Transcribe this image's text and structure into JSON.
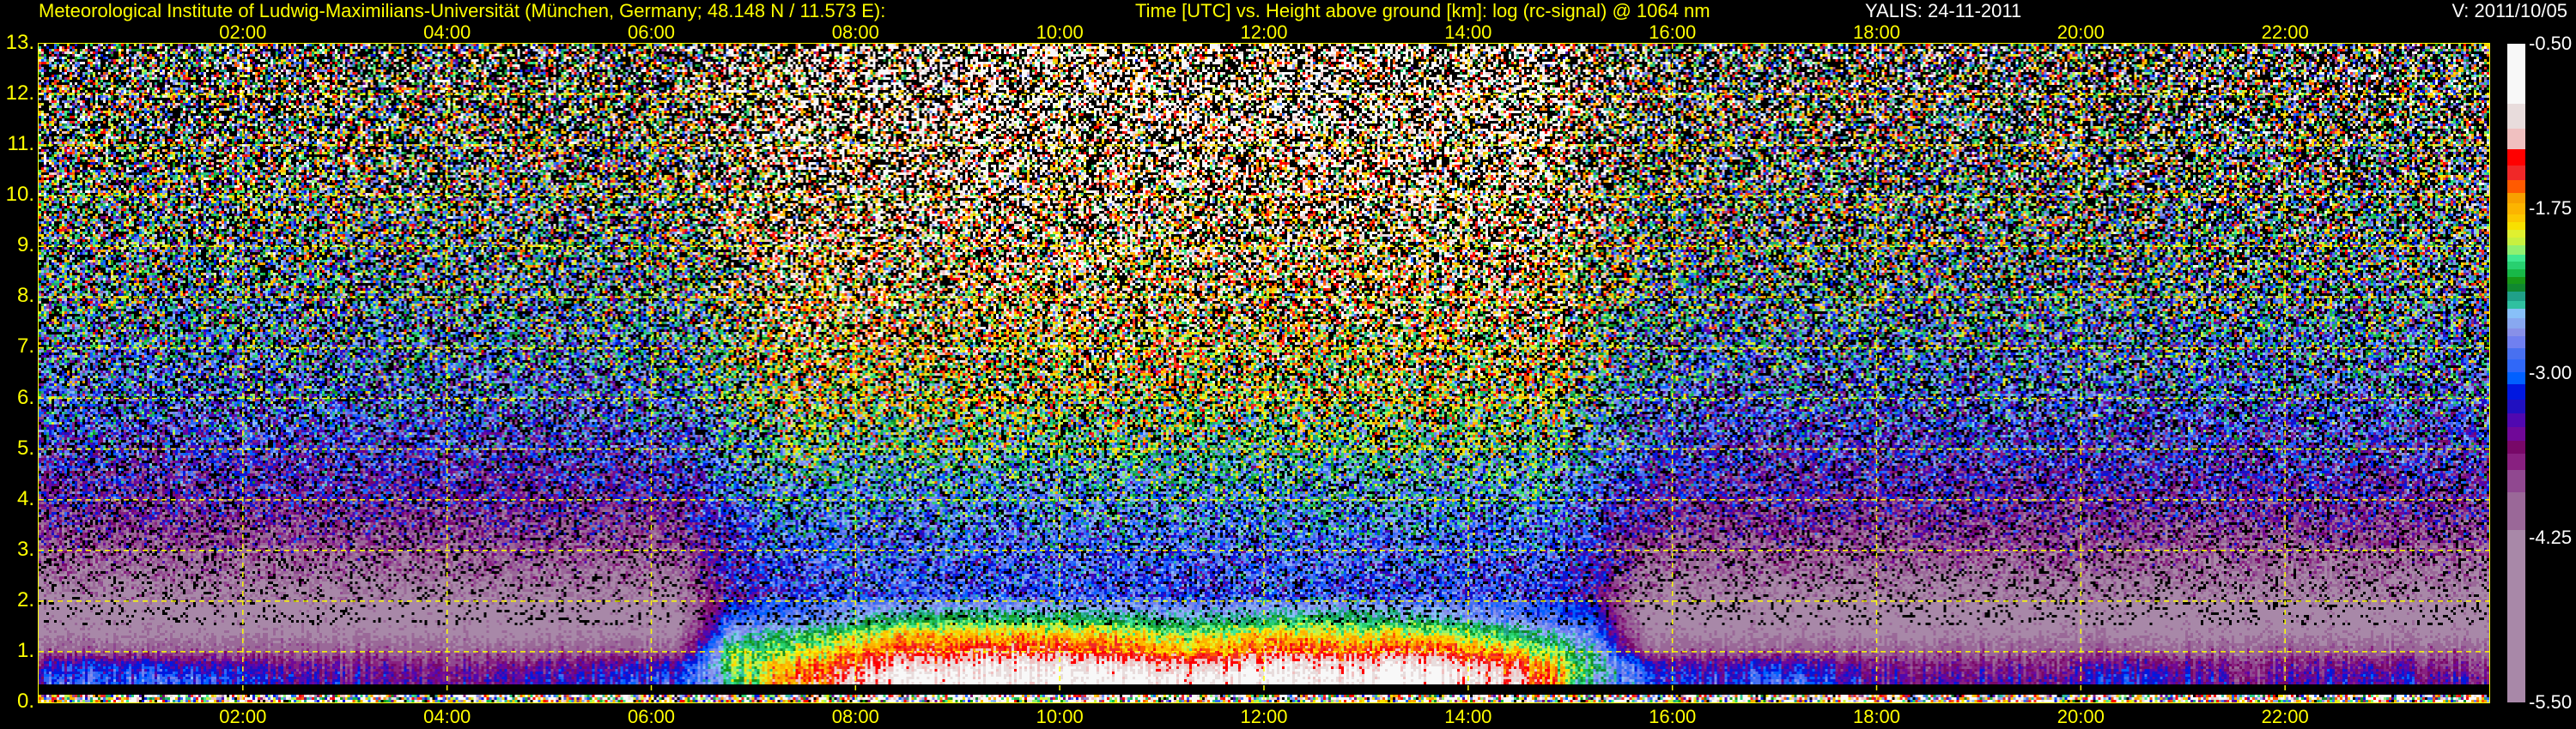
{
  "header": {
    "institute": "Meteorological Institute of Ludwig-Maximilians-Universität (München, Germany; 48.148 N / 11.573 E):",
    "description": "Time [UTC] vs. Height above ground [km]: log (rc-signal) @ 1064 nm",
    "instrument_date": "YALIS: 24-11-2011",
    "version": "V: 2011/10/05"
  },
  "colors": {
    "axis": "#ffff00",
    "grid": "#ffff00",
    "background": "#000000",
    "header_white": "#ffffff"
  },
  "chart_data": {
    "type": "heatmap",
    "title": "Time [UTC] vs. Height above ground [km]: log (rc-signal) @ 1064 nm",
    "xlabel": "Time [UTC]",
    "ylabel": "Height above ground [km]",
    "xlim_h": [
      0,
      24
    ],
    "ylim_km": [
      0,
      13
    ],
    "grid": true,
    "xticks": [
      {
        "value": 2,
        "label": "02:00"
      },
      {
        "value": 4,
        "label": "04:00"
      },
      {
        "value": 6,
        "label": "06:00"
      },
      {
        "value": 8,
        "label": "08:00"
      },
      {
        "value": 10,
        "label": "10:00"
      },
      {
        "value": 12,
        "label": "12:00"
      },
      {
        "value": 14,
        "label": "14:00"
      },
      {
        "value": 16,
        "label": "16:00"
      },
      {
        "value": 18,
        "label": "18:00"
      },
      {
        "value": 20,
        "label": "20:00"
      },
      {
        "value": 22,
        "label": "22:00"
      }
    ],
    "yticks": [
      {
        "value": 0,
        "label": "0."
      },
      {
        "value": 1,
        "label": "1."
      },
      {
        "value": 2,
        "label": "2."
      },
      {
        "value": 3,
        "label": "3."
      },
      {
        "value": 4,
        "label": "4."
      },
      {
        "value": 5,
        "label": "5."
      },
      {
        "value": 6,
        "label": "6."
      },
      {
        "value": 7,
        "label": "7."
      },
      {
        "value": 8,
        "label": "8."
      },
      {
        "value": 9,
        "label": "9."
      },
      {
        "value": 10,
        "label": "10."
      },
      {
        "value": 11,
        "label": "11."
      },
      {
        "value": 12,
        "label": "12."
      },
      {
        "value": 13,
        "label": "13."
      }
    ],
    "colorbar": {
      "range": [
        -5.5,
        -0.5
      ],
      "ticks": [
        {
          "value": -0.5,
          "label": "-0.50"
        },
        {
          "value": -1.75,
          "label": "-1.75"
        },
        {
          "value": -3.0,
          "label": "-3.00"
        },
        {
          "value": -4.25,
          "label": "-4.25"
        },
        {
          "value": -5.5,
          "label": "-5.50"
        }
      ],
      "segments": [
        [
          -5.5,
          "#a888a8"
        ],
        [
          -4.19,
          "#9a6898"
        ],
        [
          -3.9,
          "#904890"
        ],
        [
          -3.73,
          "#882080"
        ],
        [
          -3.61,
          "#780868"
        ],
        [
          -3.51,
          "#700898"
        ],
        [
          -3.41,
          "#5008b0"
        ],
        [
          -3.3,
          "#2010c0"
        ],
        [
          -3.2,
          "#0018e0"
        ],
        [
          -3.08,
          "#0060ff"
        ],
        [
          -2.99,
          "#3068f8"
        ],
        [
          -2.89,
          "#4870f0"
        ],
        [
          -2.81,
          "#7080f0"
        ],
        [
          -2.72,
          "#8890e8"
        ],
        [
          -2.66,
          "#88a8f0"
        ],
        [
          -2.58,
          "#88c0f8"
        ],
        [
          -2.51,
          "#30c0a0"
        ],
        [
          -2.45,
          "#20a088"
        ],
        [
          -2.38,
          "#108830"
        ],
        [
          -2.32,
          "#189818"
        ],
        [
          -2.27,
          "#18b848"
        ],
        [
          -2.21,
          "#28d070"
        ],
        [
          -2.15,
          "#40e890"
        ],
        [
          -2.1,
          "#90f070"
        ],
        [
          -2.03,
          "#c8f040"
        ],
        [
          -1.97,
          "#e0f030"
        ],
        [
          -1.91,
          "#f8e000"
        ],
        [
          -1.85,
          "#fcc800"
        ],
        [
          -1.79,
          "#fcb400"
        ],
        [
          -1.71,
          "#f8a000"
        ],
        [
          -1.63,
          "#ff5a00"
        ],
        [
          -1.53,
          "#f02828"
        ],
        [
          -1.42,
          "#ff0000"
        ],
        [
          -1.3,
          "#f0c0c0"
        ],
        [
          -1.14,
          "#e8dcdc"
        ],
        [
          -0.95,
          "#f8f8f8"
        ]
      ]
    },
    "time_start_h": 0,
    "time_step_h": 0.5,
    "height_bins_km": [
      [
        0,
        0.13
      ],
      [
        0.13,
        0.37
      ],
      [
        0.37,
        0.6
      ],
      [
        0.6,
        0.9
      ],
      [
        0.9,
        1.2
      ],
      [
        1.2,
        1.5
      ],
      [
        1.5,
        1.8
      ],
      [
        1.8,
        2.5
      ],
      [
        2.5,
        3.5
      ],
      [
        3.5,
        5
      ],
      [
        5,
        7
      ],
      [
        7,
        9
      ],
      [
        9,
        11
      ],
      [
        11,
        13
      ]
    ],
    "values": [
      [
        -1.6,
        -1.6,
        -1.6,
        -1.6,
        -1.6,
        -1.6,
        -1.6,
        -1.6,
        -1.6,
        -1.6,
        -1.6,
        -1.6,
        -1.6,
        -1.6,
        -1.5,
        -1.5,
        -1.4,
        -1.4,
        -1.4,
        -1.5,
        -1.5,
        -1.4,
        -1.5,
        -1.5,
        -1.5,
        -1.5,
        -1.4,
        -1.5,
        -1.5,
        -1.6,
        -1.6,
        -1.6,
        -1.6,
        -1.6,
        -1.6,
        -1.6,
        -1.6,
        -1.6,
        -1.6,
        -1.6,
        -1.6,
        -1.6,
        -1.6,
        -1.6,
        -1.6,
        -1.6,
        -1.6,
        -1.6
      ],
      [
        null,
        null,
        null,
        null,
        null,
        null,
        null,
        null,
        null,
        null,
        null,
        null,
        null,
        null,
        null,
        null,
        null,
        null,
        null,
        null,
        null,
        null,
        null,
        null,
        null,
        null,
        null,
        null,
        null,
        null,
        null,
        null,
        null,
        null,
        null,
        null,
        null,
        null,
        null,
        null,
        null,
        null,
        null,
        null,
        null,
        null,
        null,
        null
      ],
      [
        -3.0,
        -3.0,
        -3.0,
        -3.1,
        -3.3,
        -3.4,
        -3.5,
        -3.5,
        -3.4,
        -3.3,
        -3.3,
        -3.2,
        -3.1,
        -2.4,
        -1.6,
        -1.4,
        -1.0,
        -0.9,
        -0.8,
        -0.8,
        -0.7,
        -0.8,
        -1.0,
        -0.8,
        -0.8,
        -0.9,
        -0.8,
        -0.9,
        -1.1,
        -1.5,
        -2.6,
        -3.0,
        -3.2,
        -3.1,
        -3.0,
        -3.3,
        -3.4,
        -3.5,
        -3.4,
        -3.6,
        -3.3,
        -3.1,
        -3.4,
        -3.6,
        -3.4,
        -3.3,
        -3.4,
        -3.5
      ],
      [
        -3.3,
        -3.2,
        -3.3,
        -3.4,
        -3.5,
        -3.6,
        -3.6,
        -3.6,
        -3.6,
        -3.5,
        -3.5,
        -3.4,
        -3.3,
        -2.2,
        -1.8,
        -1.6,
        -1.2,
        -1.1,
        -1.0,
        -1.0,
        -1.0,
        -1.1,
        -1.3,
        -1.1,
        -1.0,
        -1.1,
        -1.0,
        -1.1,
        -1.3,
        -1.7,
        -2.4,
        -3.2,
        -3.4,
        -3.3,
        -3.3,
        -3.5,
        -3.6,
        -3.7,
        -3.6,
        -3.7,
        -3.5,
        -3.4,
        -3.6,
        -3.7,
        -3.6,
        -3.5,
        -3.6,
        -3.7
      ],
      [
        -4.0,
        -4.0,
        -4.0,
        -4.0,
        -4.0,
        -4.0,
        -4.0,
        -4.0,
        -4.0,
        -4.0,
        -4.0,
        -4.0,
        -4.0,
        -2.3,
        -2.1,
        -1.9,
        -1.6,
        -1.5,
        -1.4,
        -1.4,
        -1.5,
        -1.6,
        -1.8,
        -1.6,
        -1.5,
        -1.6,
        -1.5,
        -1.6,
        -1.8,
        -2.1,
        -2.6,
        -4.0,
        -4.0,
        -4.0,
        -4.0,
        -4.0,
        -4.0,
        -4.0,
        -4.0,
        -4.0,
        -4.0,
        -4.0,
        -4.0,
        -4.0,
        -4.0,
        -4.0,
        -4.0,
        -4.0
      ],
      [
        -4.3,
        -4.3,
        -4.3,
        -4.3,
        -4.3,
        -4.3,
        -4.3,
        -4.3,
        -4.3,
        -4.3,
        -4.3,
        -4.3,
        -4.3,
        -2.7,
        -2.4,
        -2.2,
        -1.9,
        -1.8,
        -1.8,
        -1.8,
        -1.8,
        -1.9,
        -2.1,
        -1.9,
        -1.8,
        -1.9,
        -1.9,
        -2.0,
        -2.2,
        -2.5,
        -2.9,
        -4.3,
        -4.3,
        -4.3,
        -4.3,
        -4.3,
        -4.3,
        -4.3,
        -4.3,
        -4.3,
        -4.3,
        -4.3,
        -4.3,
        -4.3,
        -4.3,
        -4.3,
        -4.3,
        -4.3
      ],
      [
        -4.4,
        -4.4,
        -4.4,
        -4.4,
        -4.4,
        -4.4,
        -4.4,
        -4.4,
        -4.4,
        -4.4,
        -4.4,
        -4.4,
        -4.4,
        -3.0,
        -2.8,
        -2.7,
        -2.4,
        -2.3,
        -2.3,
        -2.3,
        -2.3,
        -2.4,
        -2.5,
        -2.4,
        -2.3,
        -2.3,
        -2.4,
        -2.5,
        -2.7,
        -2.9,
        -3.1,
        -4.4,
        -4.4,
        -4.4,
        -4.4,
        -4.4,
        -4.4,
        -4.4,
        -4.4,
        -4.4,
        -4.4,
        -4.4,
        -4.4,
        -4.4,
        -4.4,
        -4.4,
        -4.4,
        -4.4
      ],
      [
        -4.3,
        -4.3,
        -4.3,
        -4.3,
        -4.3,
        -4.3,
        -4.3,
        -4.3,
        -4.3,
        -4.3,
        -4.3,
        -4.3,
        -4.3,
        -3.4,
        -3.1,
        -3.0,
        -3.0,
        -3.0,
        -3.0,
        -3.0,
        -3.0,
        -3.0,
        -3.1,
        -3.0,
        -3.0,
        -3.0,
        -3.0,
        -3.0,
        -3.1,
        -3.1,
        -3.4,
        -4.3,
        -4.3,
        -4.3,
        -4.3,
        -4.3,
        -4.3,
        -4.3,
        -4.3,
        -4.3,
        -4.3,
        -4.3,
        -4.3,
        -4.3,
        -4.3,
        -4.3,
        -4.3,
        -4.3
      ],
      [
        -3.9,
        -3.9,
        -3.9,
        -3.9,
        -3.9,
        -3.9,
        -3.9,
        -3.9,
        -3.9,
        -3.9,
        -3.9,
        -3.9,
        -3.9,
        -3.2,
        -2.9,
        -2.9,
        -2.9,
        -2.9,
        -2.9,
        -2.9,
        -2.9,
        -2.9,
        -2.9,
        -2.9,
        -2.9,
        -2.9,
        -2.9,
        -2.9,
        -2.9,
        -2.9,
        -3.2,
        -3.9,
        -3.9,
        -3.9,
        -3.9,
        -3.9,
        -3.9,
        -3.9,
        -3.9,
        -3.9,
        -3.9,
        -3.9,
        -3.9,
        -3.9,
        -3.9,
        -3.9,
        -3.9,
        -3.9
      ],
      [
        -3.4,
        -3.4,
        -3.4,
        -3.4,
        -3.4,
        -3.4,
        -3.4,
        -3.4,
        -3.4,
        -3.4,
        -3.4,
        -3.4,
        -3.3,
        -2.9,
        -2.6,
        -2.6,
        -2.6,
        -2.6,
        -2.6,
        -2.6,
        -2.6,
        -2.6,
        -2.6,
        -2.6,
        -2.6,
        -2.6,
        -2.6,
        -2.6,
        -2.6,
        -2.6,
        -2.9,
        -3.3,
        -3.4,
        -3.4,
        -3.4,
        -3.4,
        -3.4,
        -3.4,
        -3.4,
        -3.4,
        -3.4,
        -3.4,
        -3.4,
        -3.4,
        -3.4,
        -3.4,
        -3.4,
        -3.4
      ],
      [
        -2.9,
        -2.9,
        -2.9,
        -2.9,
        -2.9,
        -2.9,
        -2.9,
        -2.9,
        -2.9,
        -2.9,
        -2.9,
        -2.9,
        -2.8,
        -2.4,
        -2.0,
        -2.0,
        -2.0,
        -2.0,
        -2.0,
        -2.0,
        -2.0,
        -2.0,
        -2.0,
        -2.0,
        -2.0,
        -2.0,
        -2.0,
        -2.0,
        -2.0,
        -2.0,
        -2.4,
        -2.8,
        -2.9,
        -2.9,
        -2.9,
        -2.9,
        -2.9,
        -2.9,
        -2.9,
        -2.9,
        -2.9,
        -2.9,
        -2.9,
        -2.9,
        -2.9,
        -2.9,
        -2.9,
        -2.9
      ],
      [
        -2.5,
        -2.5,
        -2.5,
        -2.5,
        -2.5,
        -2.5,
        -2.5,
        -2.5,
        -2.5,
        -2.5,
        -2.5,
        -2.5,
        -2.4,
        -2.0,
        -1.6,
        -1.6,
        -1.6,
        -1.6,
        -1.6,
        -1.6,
        -1.6,
        -1.6,
        -1.6,
        -1.6,
        -1.6,
        -1.6,
        -1.6,
        -1.6,
        -1.6,
        -1.6,
        -2.0,
        -2.4,
        -2.5,
        -2.5,
        -2.5,
        -2.5,
        -2.5,
        -2.5,
        -2.5,
        -2.5,
        -2.5,
        -2.5,
        -2.5,
        -2.5,
        -2.5,
        -2.5,
        -2.5,
        -2.5
      ],
      [
        -2.2,
        -2.2,
        -2.2,
        -2.2,
        -2.2,
        -2.2,
        -2.2,
        -2.2,
        -2.2,
        -2.2,
        -2.2,
        -2.2,
        -2.1,
        -1.7,
        -1.3,
        -1.3,
        -1.3,
        -1.3,
        -1.3,
        -1.3,
        -1.3,
        -1.3,
        -1.3,
        -1.3,
        -1.3,
        -1.3,
        -1.3,
        -1.3,
        -1.3,
        -1.3,
        -1.8,
        -2.1,
        -2.2,
        -2.2,
        -2.2,
        -2.2,
        -2.2,
        -2.2,
        -2.2,
        -2.2,
        -2.2,
        -2.2,
        -2.2,
        -2.2,
        -2.2,
        -2.2,
        -2.2,
        -2.2
      ],
      [
        -2.0,
        -2.0,
        -2.0,
        -2.0,
        -2.0,
        -2.0,
        -2.0,
        -2.0,
        -2.0,
        -2.0,
        -2.0,
        -2.0,
        -1.9,
        -1.4,
        -0.9,
        -0.9,
        -0.9,
        -0.9,
        -0.9,
        -0.9,
        -0.9,
        -0.9,
        -0.9,
        -0.9,
        -0.9,
        -0.9,
        -0.9,
        -0.9,
        -0.9,
        -0.9,
        -1.5,
        -1.9,
        -2.0,
        -2.0,
        -2.0,
        -2.0,
        -2.0,
        -2.0,
        -2.0,
        -2.0,
        -2.0,
        -2.0,
        -2.0,
        -2.0,
        -2.0,
        -2.0,
        -2.0,
        -2.0
      ]
    ]
  }
}
